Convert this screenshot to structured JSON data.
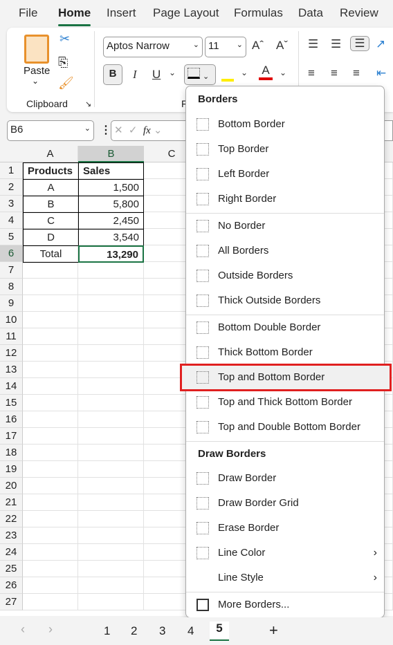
{
  "tabs": [
    "File",
    "Home",
    "Insert",
    "Page Layout",
    "Formulas",
    "Data",
    "Review"
  ],
  "active_tab": "Home",
  "ribbon": {
    "paste": "Paste",
    "clipboard": "Clipboard",
    "font_name": "Aptos Narrow",
    "font_size": "11",
    "group_font_partial": "F",
    "bold": "B",
    "italic": "I",
    "underline": "U"
  },
  "formula_bar": {
    "name_box": "B6",
    "fx": "fx"
  },
  "columns": [
    "A",
    "B",
    "C"
  ],
  "rows": [
    "1",
    "2",
    "3",
    "4",
    "5",
    "6",
    "7",
    "8",
    "9",
    "10",
    "11",
    "12",
    "13",
    "14",
    "15",
    "16",
    "17",
    "18",
    "19",
    "20",
    "21",
    "22",
    "23",
    "24",
    "25",
    "26",
    "27"
  ],
  "table": {
    "headers": [
      "Products",
      "Sales"
    ],
    "data": [
      [
        "A",
        "1,500"
      ],
      [
        "B",
        "5,800"
      ],
      [
        "C",
        "2,450"
      ],
      [
        "D",
        "3,540"
      ]
    ],
    "total": [
      "Total",
      "13,290"
    ]
  },
  "menu": {
    "section1": "Borders",
    "items1": [
      "Bottom Border",
      "Top Border",
      "Left Border",
      "Right Border"
    ],
    "items2": [
      "No Border",
      "All Borders",
      "Outside Borders",
      "Thick Outside Borders"
    ],
    "items3": [
      "Bottom Double Border",
      "Thick Bottom Border",
      "Top and Bottom Border",
      "Top and Thick Bottom Border",
      "Top and Double Bottom Border"
    ],
    "section2": "Draw Borders",
    "items4": [
      "Draw Border",
      "Draw Border Grid",
      "Erase Border",
      "Line Color",
      "Line Style"
    ],
    "more": "More Borders...",
    "highlighted": "Top and Bottom Border"
  },
  "sheets": [
    "1",
    "2",
    "3",
    "4",
    "5"
  ],
  "active_sheet": "5",
  "colors": {
    "accent": "#1a7343",
    "highlight_box": "#e02020",
    "fill_color": "#ffee00",
    "font_color": "#e00000"
  }
}
